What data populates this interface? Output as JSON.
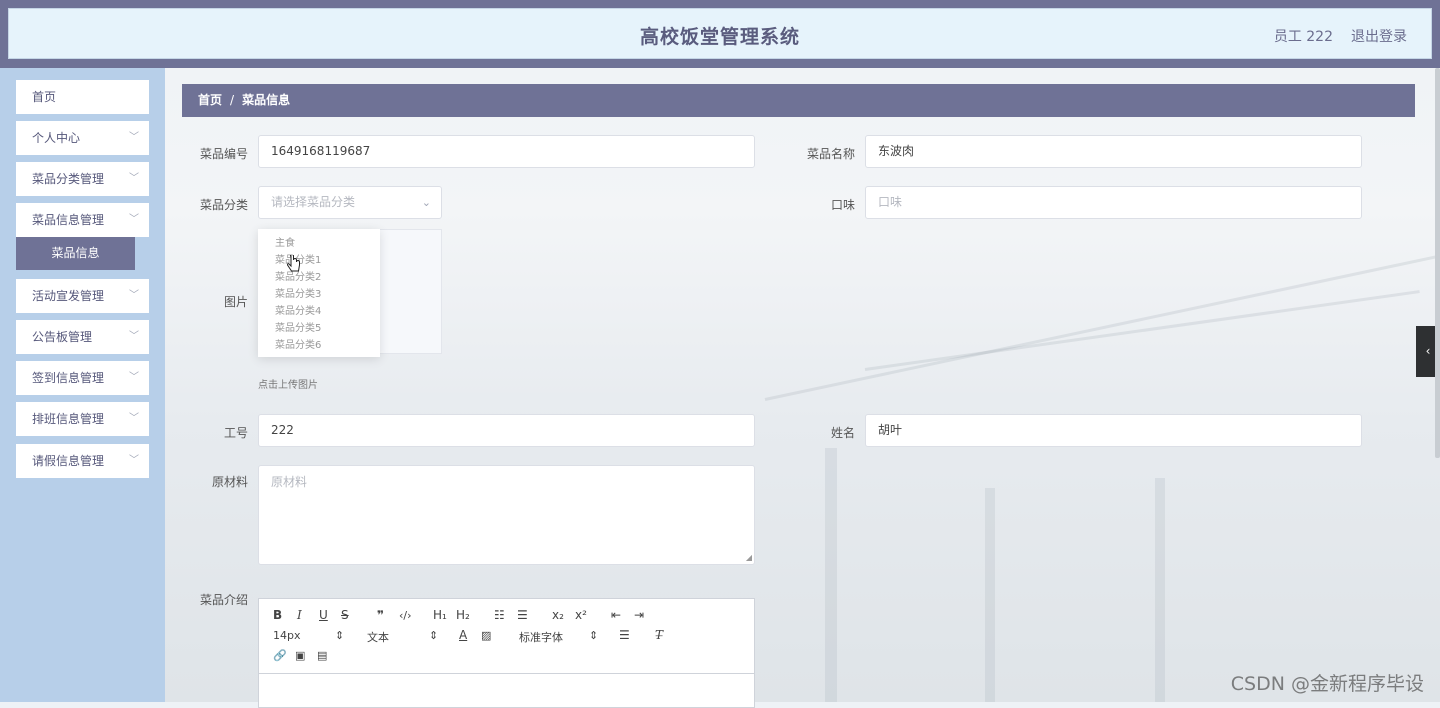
{
  "header": {
    "title": "高校饭堂管理系统",
    "user": "员工 222",
    "logout": "退出登录"
  },
  "sidebar": {
    "items": [
      {
        "label": "首页"
      },
      {
        "label": "个人中心"
      },
      {
        "label": "菜品分类管理"
      },
      {
        "label": "菜品信息管理"
      },
      {
        "label": "活动宣发管理"
      },
      {
        "label": "公告板管理"
      },
      {
        "label": "签到信息管理"
      },
      {
        "label": "排班信息管理"
      },
      {
        "label": "请假信息管理"
      }
    ],
    "active_sub": "菜品信息"
  },
  "breadcrumb": {
    "home": "首页",
    "separator": "/",
    "current": "菜品信息"
  },
  "form": {
    "code_label": "菜品编号",
    "code_value": "1649168119687",
    "name_label": "菜品名称",
    "name_value": "东波肉",
    "category_label": "菜品分类",
    "category_placeholder": "请选择菜品分类",
    "taste_label": "口味",
    "taste_placeholder": "口味",
    "image_label": "图片",
    "upload_hint": "点击上传图片",
    "staff_no_label": "工号",
    "staff_no_value": "222",
    "staff_name_label": "姓名",
    "staff_name_value": "胡叶",
    "material_label": "原材料",
    "material_placeholder": "原材料",
    "intro_label": "菜品介绍"
  },
  "category_options": [
    "主食",
    "菜品分类1",
    "菜品分类2",
    "菜品分类3",
    "菜品分类4",
    "菜品分类5",
    "菜品分类6"
  ],
  "editor": {
    "font_size": "14px",
    "header_select": "文本",
    "font_family": "标准字体"
  },
  "watermark": "CSDN @金新程序毕设"
}
